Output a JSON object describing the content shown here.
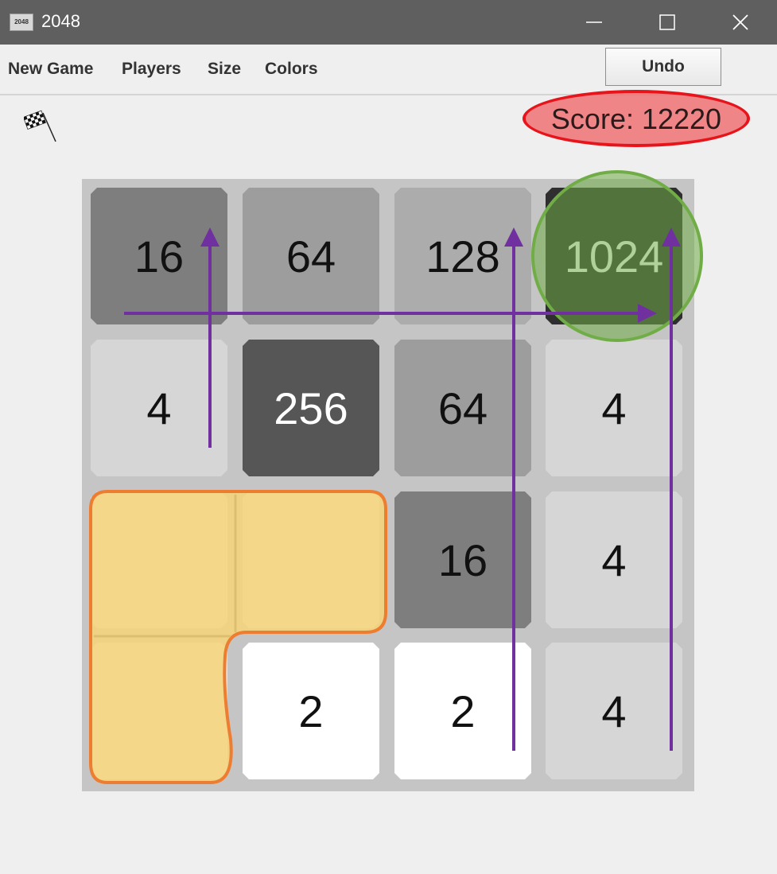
{
  "window": {
    "title": "2048",
    "icon_label": "2048",
    "controls": [
      "minimize-icon",
      "maximize-icon",
      "close-icon"
    ]
  },
  "menu": {
    "items": [
      "New Game",
      "Players",
      "Size",
      "Colors"
    ],
    "undo_label": "Undo"
  },
  "status": {
    "flag_icon": "checkered-flag-icon",
    "score_text": "Score: 12220"
  },
  "board": {
    "size": 4,
    "cells": [
      [
        "16",
        "64",
        "128",
        "1024"
      ],
      [
        "4",
        "256",
        "64",
        "4"
      ],
      [
        "",
        "",
        "16",
        "4"
      ],
      [
        "",
        "2",
        "2",
        "4"
      ]
    ]
  },
  "colors": {
    "frame": "#5f5f5f",
    "board": "#c5c5c5",
    "tile_2": "#ffffff",
    "tile_4": "#d6d6d6",
    "tile_16": "#7e7e7e",
    "tile_64": "#9d9d9d",
    "tile_128": "#acacac",
    "tile_256": "#565656",
    "tile_1024": "#2f2f2f",
    "score_highlight": "#e8141c",
    "merge_arrows": "#7030a0",
    "tile_1024_highlight": "#70ad47",
    "empty_region_highlight": "#f5d98b"
  }
}
